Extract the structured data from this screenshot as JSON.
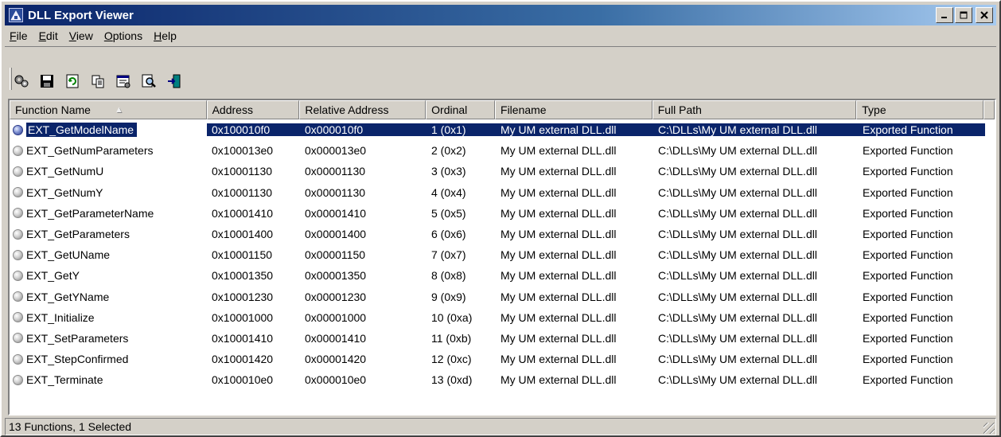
{
  "window": {
    "title": "DLL Export Viewer",
    "buttons": {
      "minimize": "_",
      "maximize": "□",
      "close": "✕"
    }
  },
  "menu": [
    {
      "label": "File",
      "accel": "F",
      "rest": "ile"
    },
    {
      "label": "Edit",
      "accel": "E",
      "rest": "dit"
    },
    {
      "label": "View",
      "accel": "V",
      "rest": "iew"
    },
    {
      "label": "Options",
      "accel": "O",
      "rest": "ptions"
    },
    {
      "label": "Help",
      "accel": "H",
      "rest": "elp"
    }
  ],
  "toolbar": {
    "icons": [
      "properties-gear-icon",
      "save-icon",
      "refresh-icon",
      "copy-icon",
      "properties-icon",
      "find-icon",
      "exit-icon"
    ]
  },
  "columns": [
    "Function Name",
    "Address",
    "Relative Address",
    "Ordinal",
    "Filename",
    "Full Path",
    "Type"
  ],
  "rows": [
    {
      "name": "EXT_GetModelName",
      "address": "0x100010f0",
      "relative": "0x000010f0",
      "ordinal": "1 (0x1)",
      "filename": "My UM external DLL.dll",
      "path": "C:\\DLLs\\My UM external DLL.dll",
      "type": "Exported Function",
      "selected": true
    },
    {
      "name": "EXT_GetNumParameters",
      "address": "0x100013e0",
      "relative": "0x000013e0",
      "ordinal": "2 (0x2)",
      "filename": "My UM external DLL.dll",
      "path": "C:\\DLLs\\My UM external DLL.dll",
      "type": "Exported Function"
    },
    {
      "name": "EXT_GetNumU",
      "address": "0x10001130",
      "relative": "0x00001130",
      "ordinal": "3 (0x3)",
      "filename": "My UM external DLL.dll",
      "path": "C:\\DLLs\\My UM external DLL.dll",
      "type": "Exported Function"
    },
    {
      "name": "EXT_GetNumY",
      "address": "0x10001130",
      "relative": "0x00001130",
      "ordinal": "4 (0x4)",
      "filename": "My UM external DLL.dll",
      "path": "C:\\DLLs\\My UM external DLL.dll",
      "type": "Exported Function"
    },
    {
      "name": "EXT_GetParameterName",
      "address": "0x10001410",
      "relative": "0x00001410",
      "ordinal": "5 (0x5)",
      "filename": "My UM external DLL.dll",
      "path": "C:\\DLLs\\My UM external DLL.dll",
      "type": "Exported Function"
    },
    {
      "name": "EXT_GetParameters",
      "address": "0x10001400",
      "relative": "0x00001400",
      "ordinal": "6 (0x6)",
      "filename": "My UM external DLL.dll",
      "path": "C:\\DLLs\\My UM external DLL.dll",
      "type": "Exported Function"
    },
    {
      "name": "EXT_GetUName",
      "address": "0x10001150",
      "relative": "0x00001150",
      "ordinal": "7 (0x7)",
      "filename": "My UM external DLL.dll",
      "path": "C:\\DLLs\\My UM external DLL.dll",
      "type": "Exported Function"
    },
    {
      "name": "EXT_GetY",
      "address": "0x10001350",
      "relative": "0x00001350",
      "ordinal": "8 (0x8)",
      "filename": "My UM external DLL.dll",
      "path": "C:\\DLLs\\My UM external DLL.dll",
      "type": "Exported Function"
    },
    {
      "name": "EXT_GetYName",
      "address": "0x10001230",
      "relative": "0x00001230",
      "ordinal": "9 (0x9)",
      "filename": "My UM external DLL.dll",
      "path": "C:\\DLLs\\My UM external DLL.dll",
      "type": "Exported Function"
    },
    {
      "name": "EXT_Initialize",
      "address": "0x10001000",
      "relative": "0x00001000",
      "ordinal": "10 (0xa)",
      "filename": "My UM external DLL.dll",
      "path": "C:\\DLLs\\My UM external DLL.dll",
      "type": "Exported Function"
    },
    {
      "name": "EXT_SetParameters",
      "address": "0x10001410",
      "relative": "0x00001410",
      "ordinal": "11 (0xb)",
      "filename": "My UM external DLL.dll",
      "path": "C:\\DLLs\\My UM external DLL.dll",
      "type": "Exported Function"
    },
    {
      "name": "EXT_StepConfirmed",
      "address": "0x10001420",
      "relative": "0x00001420",
      "ordinal": "12 (0xc)",
      "filename": "My UM external DLL.dll",
      "path": "C:\\DLLs\\My UM external DLL.dll",
      "type": "Exported Function"
    },
    {
      "name": "EXT_Terminate",
      "address": "0x100010e0",
      "relative": "0x000010e0",
      "ordinal": "13 (0xd)",
      "filename": "My UM external DLL.dll",
      "path": "C:\\DLLs\\My UM external DLL.dll",
      "type": "Exported Function"
    }
  ],
  "status": {
    "text": "13 Functions, 1 Selected"
  },
  "colors": {
    "title_start": "#0a246a",
    "title_end": "#a6caf0",
    "selection": "#0a246a",
    "face": "#d4d0c8"
  }
}
